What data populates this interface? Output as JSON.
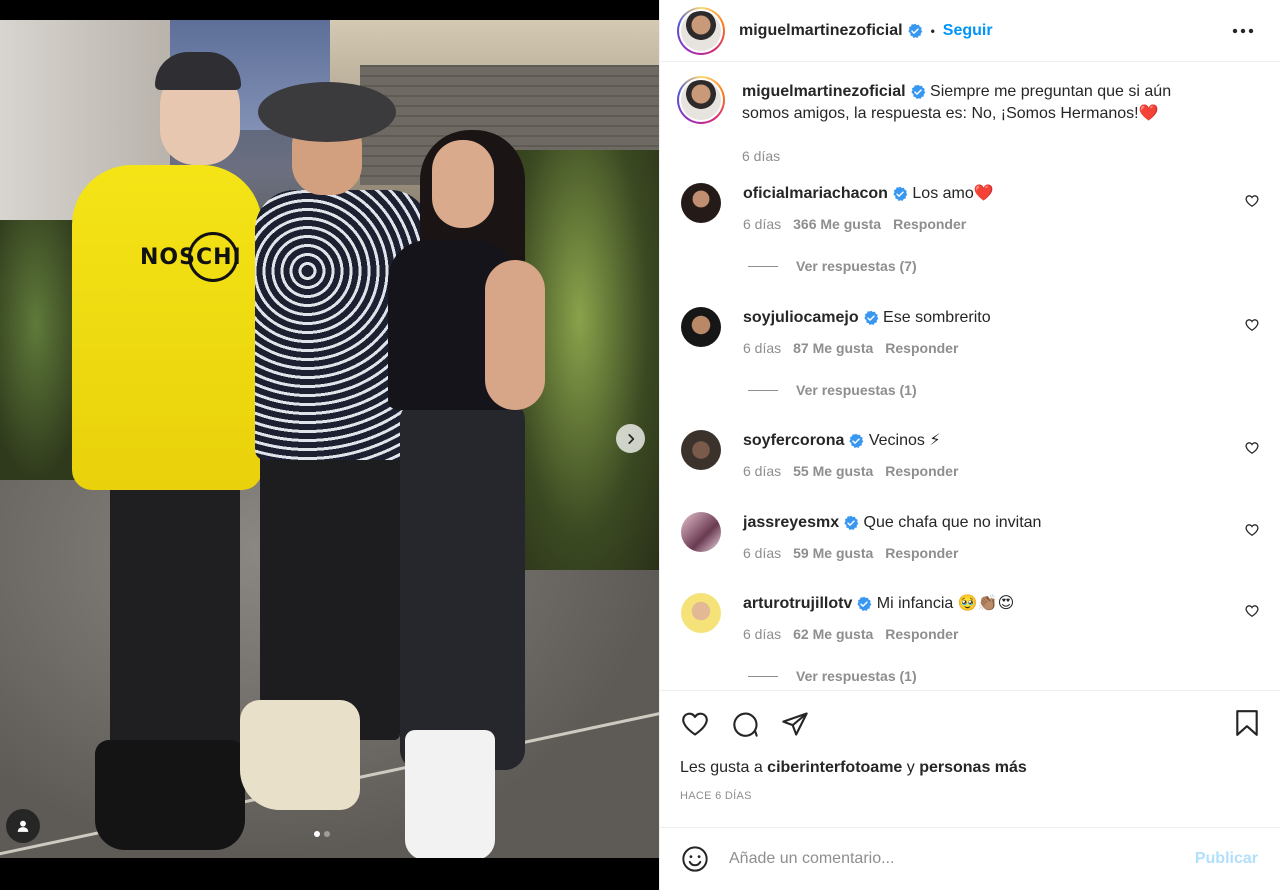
{
  "colors": {
    "accent": "#0095f6",
    "text": "#262626",
    "muted": "#8e8e8e",
    "heart_emoji": "#e0245e",
    "publish_disabled": "#b2dffc"
  },
  "photo": {
    "sweater_text": "NOSCHI",
    "carousel_total": 2,
    "carousel_active": 1
  },
  "header": {
    "username": "miguelmartinezoficial",
    "separator": "•",
    "follow_label": "Seguir",
    "more_icon": "more-horizontal-icon"
  },
  "caption": {
    "username": "miguelmartinezoficial",
    "text": "Siempre me preguntan que si aún somos amigos, la respuesta es: No, ¡Somos Hermanos!❤️",
    "time": "6 días"
  },
  "comments": [
    {
      "username": "oficialmariachacon",
      "text": "Los amo❤️",
      "time": "6 días",
      "likes": "366 Me gusta",
      "reply": "Responder",
      "view_replies": "Ver respuestas (7)"
    },
    {
      "username": "soyjuliocamejo",
      "text": "Ese sombrerito",
      "time": "6 días",
      "likes": "87 Me gusta",
      "reply": "Responder",
      "view_replies": "Ver respuestas (1)"
    },
    {
      "username": "soyfercorona",
      "text": "Vecinos ⚡",
      "time": "6 días",
      "likes": "55 Me gusta",
      "reply": "Responder"
    },
    {
      "username": "jassreyesmx",
      "text": "Que chafa que no invitan",
      "time": "6 días",
      "likes": "59 Me gusta",
      "reply": "Responder"
    },
    {
      "username": "arturotrujillotv",
      "text": "Mi infancia 🥹👏🏽😍",
      "time": "6 días",
      "likes": "62 Me gusta",
      "reply": "Responder",
      "view_replies": "Ver respuestas (1)"
    }
  ],
  "actions": {
    "likes_prefix": "Les gusta a ",
    "likes_user": "ciberinterfotoame",
    "likes_mid": " y ",
    "likes_suffix": "personas más",
    "timestamp": "HACE 6 DÍAS"
  },
  "composer": {
    "placeholder": "Añade un comentario...",
    "publish_label": "Publicar"
  }
}
